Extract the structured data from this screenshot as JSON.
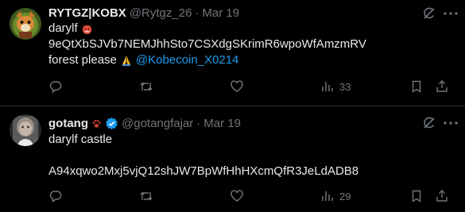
{
  "colors": {
    "background": "#000000",
    "text": "#e7e9ea",
    "muted": "#71767b",
    "link": "#1d9bf0",
    "divider": "#2f3336",
    "verified": "#1d9bf0"
  },
  "tweets": [
    {
      "display_name": "RYTGZ|KOBX",
      "handle": "@Rytgz_26",
      "separator": "·",
      "date": "Mar 19",
      "name_emoji": "",
      "verified": false,
      "lines": [
        {
          "text": "darylf",
          "emoji": "devil-face-icon"
        },
        {
          "text": "9eQtXbSJVb7NEMJhhSto7CSXdgSKrimR6wpoWfAmzmRV"
        },
        {
          "text": "forest please",
          "emoji": "folded-hands-icon",
          "mention": "@Kobecoin_X0214"
        }
      ],
      "replies": "",
      "retweets": "",
      "likes": "",
      "views": "33"
    },
    {
      "display_name": "gotang",
      "handle": "@gotangfajar",
      "separator": "·",
      "date": "Mar 19",
      "name_emoji": "paw-prints-icon",
      "verified": true,
      "lines": [
        {
          "text": "darylf castle"
        },
        {
          "text": ""
        },
        {
          "text": "A94xqwo2Mxj5vjQ12shJW7BpWfHhHXcmQfR3JeLdADB8"
        }
      ],
      "replies": "",
      "retweets": "",
      "likes": "",
      "views": "29"
    }
  ]
}
